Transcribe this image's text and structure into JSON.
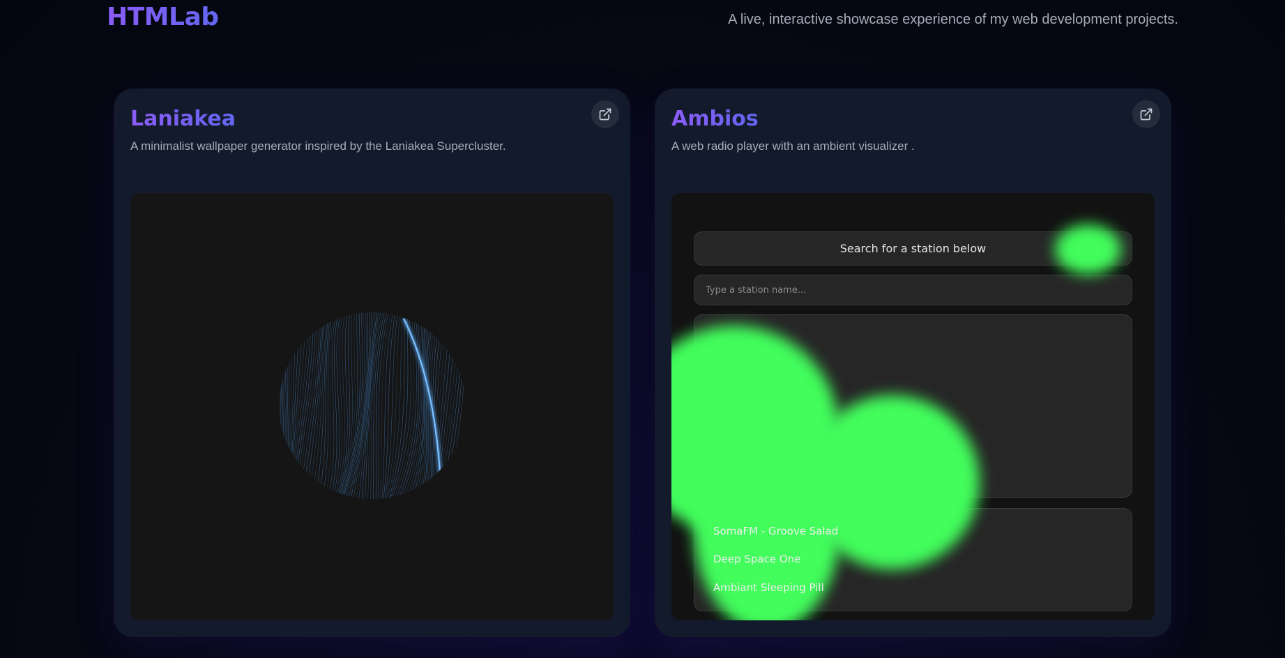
{
  "header": {
    "brand": "HTMLab",
    "tagline": "A live, interactive showcase experience of my web development projects."
  },
  "projects": [
    {
      "title": "Laniakea",
      "description": "A minimalist wallpaper generator inspired by the Laniakea Supercluster.",
      "open_icon": "external-link-icon"
    },
    {
      "title": "Ambios",
      "description": "A web radio player with an ambient visualizer .",
      "open_icon": "external-link-icon",
      "player": {
        "heading": "Search for a station below",
        "search_placeholder": "Type a station name...",
        "stations": [
          "SomaFM - Groove Salad",
          "Deep Space One",
          "Ambiant Sleeping Pill"
        ],
        "visualizer_color": "#42fd5c"
      }
    }
  ],
  "colors": {
    "accent_start": "#8b5cf6",
    "accent_end": "#6366f1",
    "card_bg": "#121a2b",
    "page_bg": "#04060f",
    "flow_line": "#4a90d9"
  }
}
